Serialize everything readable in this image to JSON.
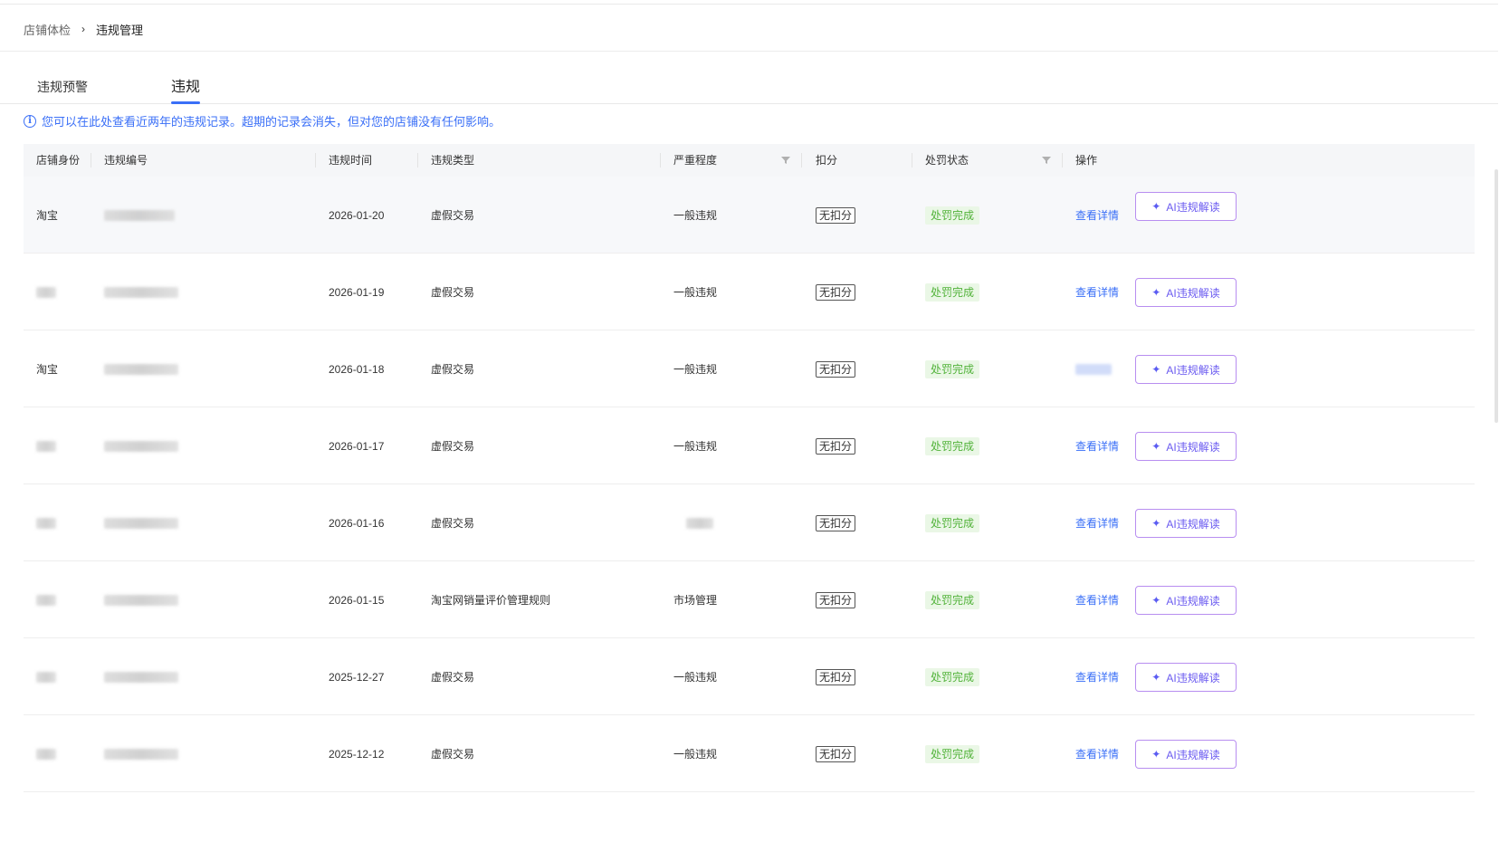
{
  "breadcrumb": {
    "parent": "店铺体检",
    "separator": "›",
    "current": "违规管理"
  },
  "tabs": [
    {
      "label": "违规预警",
      "active": false
    },
    {
      "label": "违规",
      "active": true
    }
  ],
  "notice": {
    "icon": "info-icon",
    "text": "您可以在此处查看近两年的违规记录。超期的记录会消失，但对您的店铺没有任何影响。"
  },
  "table": {
    "headers": {
      "identity": "店铺身份",
      "violation_id": "违规编号",
      "time": "违规时间",
      "type": "违规类型",
      "severity": "严重程度",
      "deduction": "扣分",
      "status": "处罚状态",
      "action": "操作"
    },
    "rows": [
      {
        "identity": "淘宝",
        "time": "2026-01-20",
        "type": "虚假交易",
        "severity": "一般违规",
        "deduction": "无扣分",
        "status": "处罚完成",
        "detail": "查看详情",
        "ai": "AI违规解读"
      },
      {
        "identity": "",
        "time": "2026-01-19",
        "type": "虚假交易",
        "severity": "一般违规",
        "deduction": "无扣分",
        "status": "处罚完成",
        "detail": "查看详情",
        "ai": "AI违规解读"
      },
      {
        "identity": "淘宝",
        "time": "2026-01-18",
        "type": "虚假交易",
        "severity": "一般违规",
        "deduction": "无扣分",
        "status": "处罚完成",
        "detail": "",
        "ai": "AI违规解读"
      },
      {
        "identity": "",
        "time": "2026-01-17",
        "type": "虚假交易",
        "severity": "一般违规",
        "deduction": "无扣分",
        "status": "处罚完成",
        "detail": "查看详情",
        "ai": "AI违规解读"
      },
      {
        "identity": "",
        "time": "2026-01-16",
        "type": "虚假交易",
        "severity": "",
        "deduction": "无扣分",
        "status": "处罚完成",
        "detail": "查看详情",
        "ai": "AI违规解读"
      },
      {
        "identity": "",
        "time": "2026-01-15",
        "type": "淘宝网销量评价管理规则",
        "severity": "市场管理",
        "deduction": "无扣分",
        "status": "处罚完成",
        "detail": "查看详情",
        "ai": "AI违规解读"
      },
      {
        "identity": "",
        "time": "2025-12-27",
        "type": "虚假交易",
        "severity": "一般违规",
        "deduction": "无扣分",
        "status": "处罚完成",
        "detail": "查看详情",
        "ai": "AI违规解读"
      },
      {
        "identity": "",
        "time": "2025-12-12",
        "type": "虚假交易",
        "severity": "一般违规",
        "deduction": "无扣分",
        "status": "处罚完成",
        "detail": "查看详情",
        "ai": "AI违规解读"
      }
    ]
  },
  "colors": {
    "accent": "#3a6ff7",
    "success": "#52b33a",
    "ai_border": "#b88ef0"
  }
}
